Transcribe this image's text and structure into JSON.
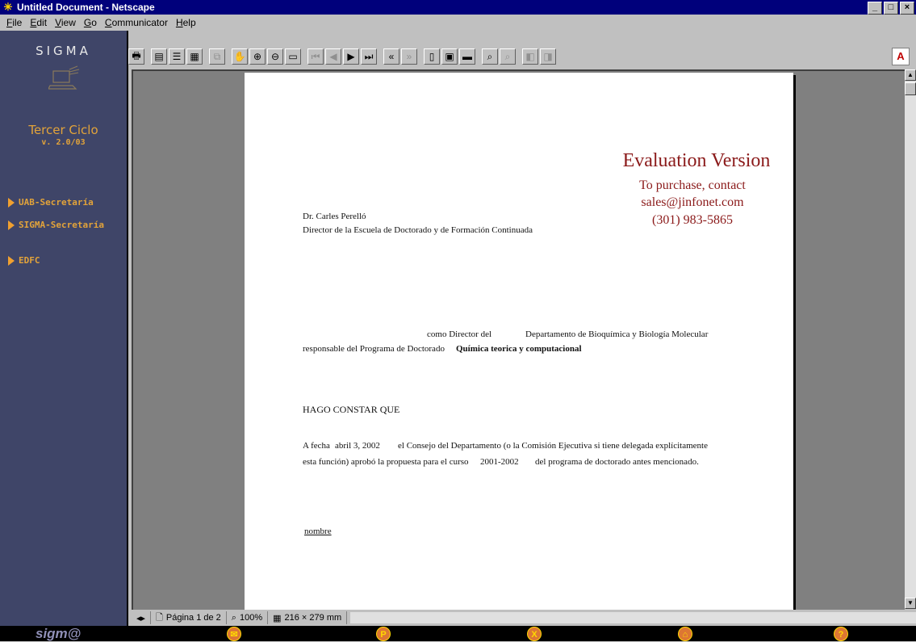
{
  "window": {
    "title": "Untitled Document - Netscape",
    "controls": [
      "_",
      "□",
      "×"
    ]
  },
  "menu": [
    "File",
    "Edit",
    "View",
    "Go",
    "Communicator",
    "Help"
  ],
  "sidebar": {
    "title": "SIGMA",
    "product": "Tercer Ciclo",
    "version": "v. 2.0/03",
    "links": [
      {
        "label": "UAB-Secretaría"
      },
      {
        "label": "SIGMA-Secretaría"
      },
      {
        "label": "EDFC"
      }
    ]
  },
  "document": {
    "evaluation": {
      "title": "Evaluation Version",
      "line1": "To purchase, contact",
      "line2": "sales@jinfonet.com",
      "line3": "(301) 983-5865"
    },
    "recipient_name": "Dr. Carles Perelló",
    "recipient_role": "Director de la Escuela de Doctorado y de Formación Continuada",
    "director_prefix": "como Director del",
    "department": "Departamento de Bioquímica y Biología Molecular",
    "program_prefix": "responsable del Programa de Doctorado",
    "program_name": "Química teorica y computacional",
    "heading": "HAGO CONSTAR QUE",
    "para1_a": "A fecha",
    "para1_date": "abril 3, 2002",
    "para1_b": "el Consejo del Departamento (o la Comisión Ejecutiva si tiene delegada explícitamente",
    "para2_a": "esta función) aprobó la propuesta para el curso",
    "para2_course": "2001-2002",
    "para2_b": "del programa de doctorado antes mencionado.",
    "signature_label": "nombre"
  },
  "statusbar": {
    "page": "Página 1 de 2",
    "zoom": "100%",
    "size": "216 × 279 mm"
  },
  "footer": {
    "brand": "sigm@"
  }
}
